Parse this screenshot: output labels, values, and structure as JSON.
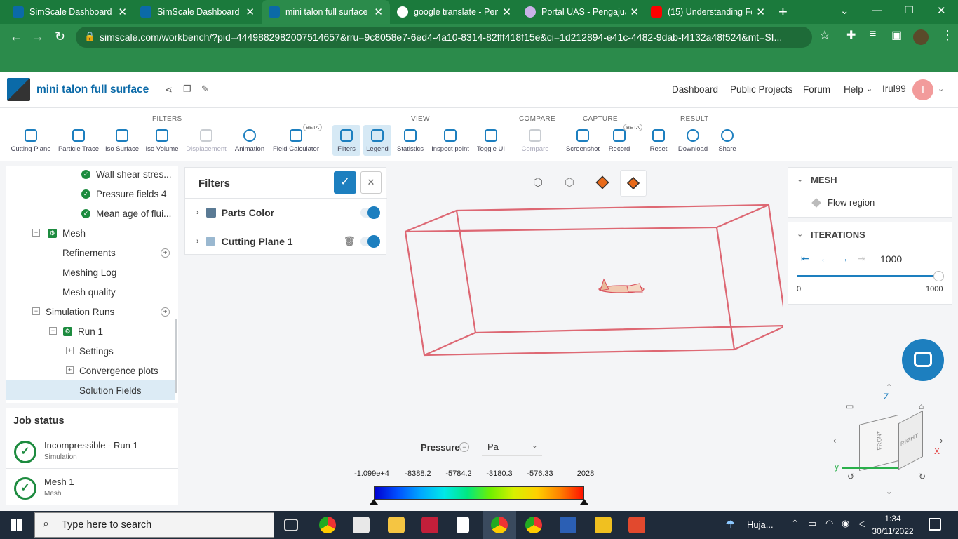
{
  "browser": {
    "tabs": [
      {
        "title": "SimScale Dashboard -",
        "close": "✕"
      },
      {
        "title": "SimScale Dashboard -",
        "close": "✕"
      },
      {
        "title": "mini talon full surface",
        "close": "✕"
      },
      {
        "title": "google translate - Pen",
        "close": "✕"
      },
      {
        "title": "Portal UAS - Pengajua",
        "close": "✕"
      },
      {
        "title": "(15) Understanding Fo",
        "close": "✕"
      }
    ],
    "new_tab": "+",
    "url": "simscale.com/workbench/?pid=4449882982007514657&rru=9c8058e7-6ed4-4a10-8314-82fff418f15e&ci=1d212894-e41c-4482-9dab-f4132a48f524&mt=SI..."
  },
  "header": {
    "project_title": "mini talon full surface",
    "nav": [
      "Dashboard",
      "Public Projects",
      "Forum",
      "Help"
    ],
    "user": "Irul99",
    "avatar_letter": "I"
  },
  "toolbar": {
    "groups": [
      "FILTERS",
      "VIEW",
      "COMPARE",
      "CAPTURE",
      "RESULT"
    ],
    "beta": "BETA",
    "tools": [
      "Cutting Plane",
      "Particle Trace",
      "Iso Surface",
      "Iso Volume",
      "Displacement",
      "Animation",
      "Field Calculator",
      "Filters",
      "Legend",
      "Statistics",
      "Inspect point",
      "Toggle UI",
      "Compare",
      "Screenshot",
      "Record",
      "Reset",
      "Download",
      "Share"
    ]
  },
  "tree": {
    "items": [
      "Wall shear stres...",
      "Pressure fields 4",
      "Mean age of flui...",
      "Mesh",
      "Refinements",
      "Meshing Log",
      "Mesh quality",
      "Simulation Runs",
      "Run 1",
      "Settings",
      "Convergence plots",
      "Solution Fields"
    ]
  },
  "job_status": {
    "title": "Job status",
    "jobs": [
      {
        "name": "Incompressible - Run 1",
        "type": "Simulation"
      },
      {
        "name": "Mesh 1",
        "type": "Mesh"
      }
    ]
  },
  "filters_panel": {
    "title": "Filters",
    "rows": [
      "Parts Color",
      "Cutting Plane 1"
    ]
  },
  "mesh_panel": {
    "title": "MESH",
    "item": "Flow region"
  },
  "iterations_panel": {
    "title": "ITERATIONS",
    "value": "1000",
    "min": "0",
    "max": "1000",
    "slider_fraction": 1.0
  },
  "legend": {
    "field": "Pressure",
    "unit": "Pa",
    "ticks": [
      "-1.099e+4",
      "-8388.2",
      "-5784.2",
      "-3180.3",
      "-576.33",
      "2028"
    ]
  },
  "viewcube": {
    "z": "Z",
    "y": "y",
    "x": "X",
    "front": "FRONT",
    "right": "RIGHT"
  },
  "taskbar": {
    "search_placeholder": "Type here to search",
    "weather": "Huja...",
    "time": "1:34",
    "date": "30/11/2022"
  },
  "colors": {
    "accent": "#1d7fbf",
    "success": "#1d8b3f",
    "browser": "#2b8b4b",
    "avatar": "#f29b9b"
  }
}
